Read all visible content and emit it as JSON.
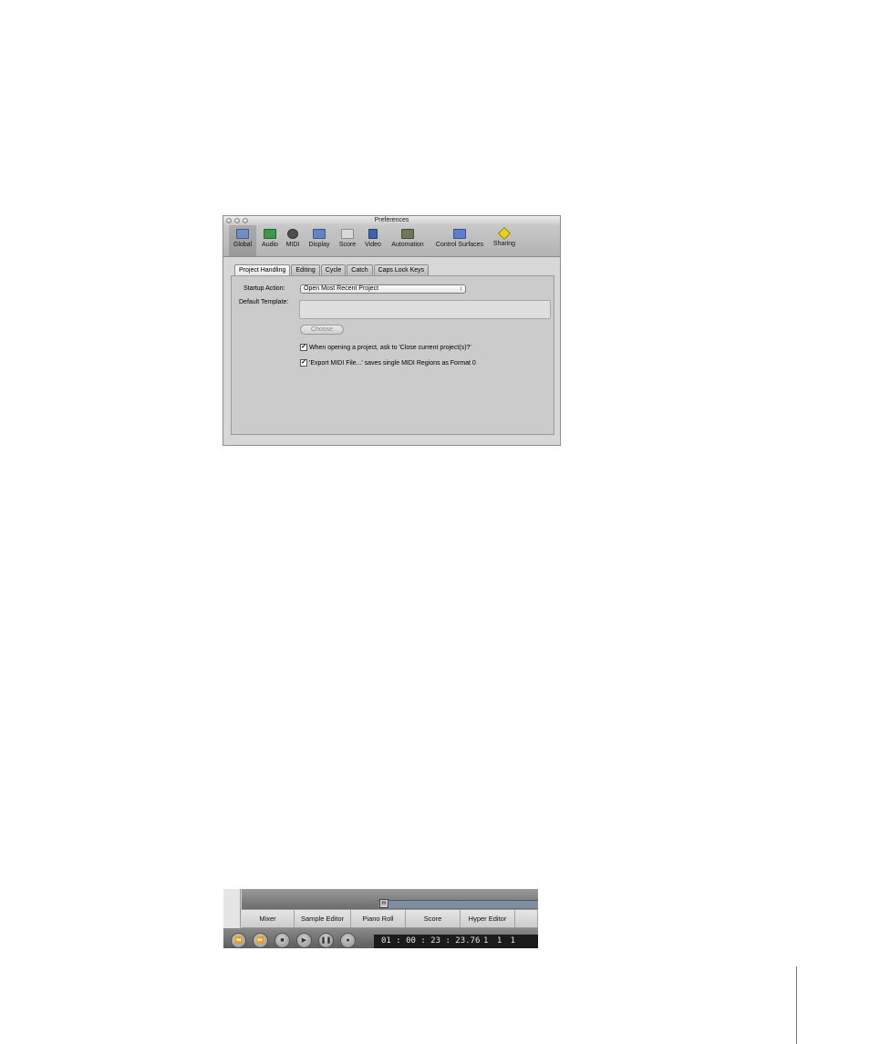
{
  "preferences": {
    "window_title": "Preferences",
    "toolbar": [
      {
        "key": "global",
        "label": "Global",
        "icon": "global-icon",
        "color": "#6f8fc4",
        "selected": true
      },
      {
        "key": "audio",
        "label": "Audio",
        "icon": "audio-icon",
        "color": "#3a9a4a"
      },
      {
        "key": "midi",
        "label": "MIDI",
        "icon": "midi-icon",
        "color": "#4d4d4d"
      },
      {
        "key": "display",
        "label": "Display",
        "icon": "display-icon",
        "color": "#5f86c9"
      },
      {
        "key": "score",
        "label": "Score",
        "icon": "score-icon",
        "color": "#d9d9d9"
      },
      {
        "key": "video",
        "label": "Video",
        "icon": "video-icon",
        "color": "#3c64b0"
      },
      {
        "key": "automation",
        "label": "Automation",
        "icon": "automation-icon",
        "color": "#6a7a55"
      },
      {
        "key": "control_surfaces",
        "label": "Control Surfaces",
        "icon": "control-surfaces-icon",
        "color": "#5a7fd0"
      },
      {
        "key": "sharing",
        "label": "Sharing",
        "icon": "sharing-icon",
        "color": "#e7d21a"
      }
    ],
    "tabs": [
      "Project Handling",
      "Editing",
      "Cycle",
      "Catch",
      "Caps Lock Keys"
    ],
    "active_tab": "Project Handling",
    "startup_action_label": "Startup Action:",
    "startup_action_value": "Open Most Recent Project",
    "popup_arrows": "↕",
    "default_template_label": "Default Template:",
    "choose_button": "Choose",
    "checkbox_1": {
      "label": "When opening a project, ask to 'Close current project(s)?'",
      "checked": true
    },
    "checkbox_2": {
      "label": "'Export MIDI File...' saves single MIDI Regions as Format 0",
      "checked": true
    },
    "check_mark": "✓"
  },
  "transport": {
    "editors": [
      "Mixer",
      "Sample Editor",
      "Piano Roll",
      "Score",
      "Hyper Editor"
    ],
    "marker_glyph": "m",
    "buttons": [
      "⏪",
      "⏩",
      "■",
      "▶",
      "❚❚",
      "●"
    ],
    "time_display": "01 : 00 : 23 : 23.76",
    "bar_display": "1   1   1"
  }
}
